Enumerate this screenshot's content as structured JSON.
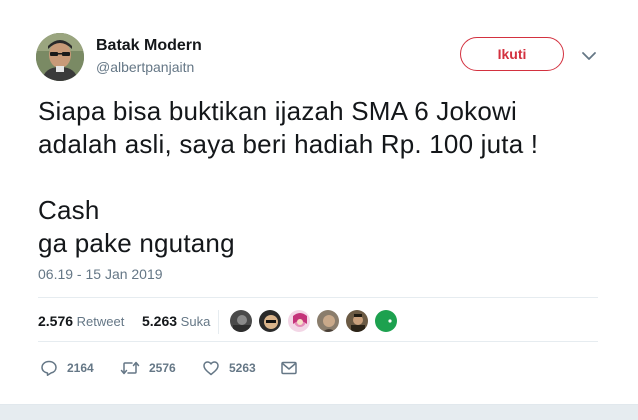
{
  "tweet": {
    "author": {
      "display_name": "Batak Modern",
      "handle": "@albertpanjaitn"
    },
    "follow_label": "Ikuti",
    "text_lines": [
      "Siapa bisa buktikan ijazah SMA 6 Jokowi",
      "adalah asli, saya beri hadiah Rp. 100 juta !",
      "",
      "Cash",
      "ga pake ngutang"
    ],
    "timestamp": "06.19 - 15 Jan 2019",
    "stats": {
      "retweet_count": "2.576",
      "retweet_label": "Retweet",
      "like_count": "5.263",
      "like_label": "Suka"
    },
    "actions": {
      "reply_count": "2164",
      "retweet_count": "2576",
      "like_count": "5263"
    }
  },
  "colors": {
    "follow_accent": "#d3313f",
    "secondary_text": "#657786",
    "primary_text": "#14171a"
  },
  "icons": [
    "chevron-down-icon",
    "reply-icon",
    "retweet-icon",
    "heart-icon",
    "message-icon"
  ]
}
